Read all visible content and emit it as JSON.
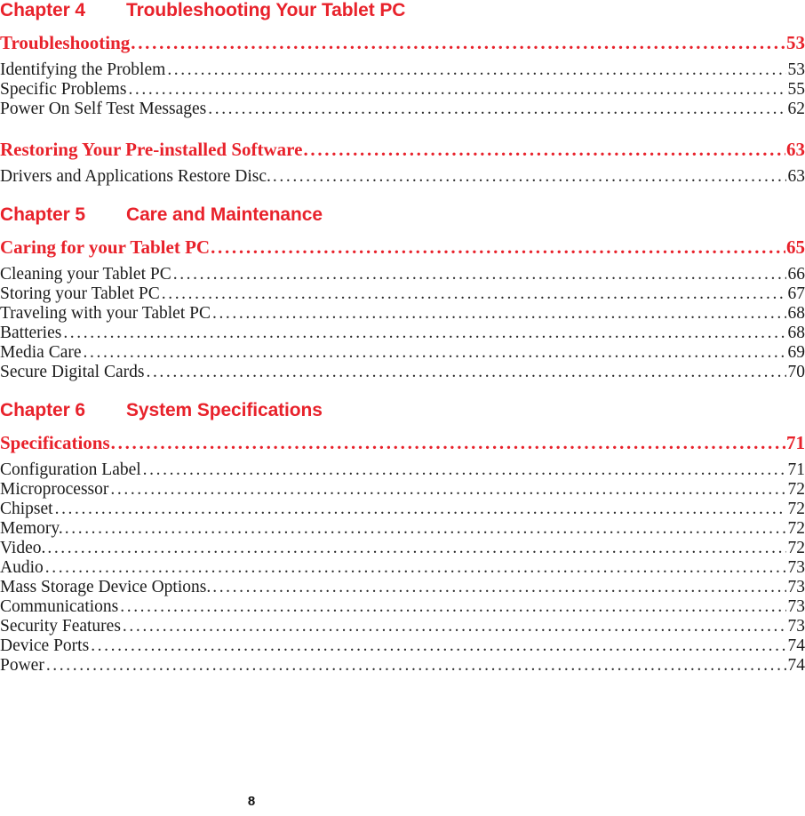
{
  "document": {
    "page_number": "8",
    "accent_color": "#E8222B",
    "body_color": "#1b1b1b",
    "leader_char": "."
  },
  "chapters": [
    {
      "label": "Chapter 4",
      "title": "Troubleshooting Your Tablet PC",
      "sections": [
        {
          "title": "Troubleshooting",
          "page": "53",
          "entries": [
            {
              "title": "Identifying the Problem",
              "page": "53"
            },
            {
              "title": "Specific Problems",
              "page": "55"
            },
            {
              "title": "Power On Self Test Messages",
              "page": "62"
            }
          ]
        },
        {
          "title": "Restoring Your Pre-installed Software",
          "page": "63",
          "entries": [
            {
              "title": "Drivers and Applications Restore Disc.",
              "page": "63"
            }
          ]
        }
      ]
    },
    {
      "label": "Chapter 5",
      "title": "Care and Maintenance",
      "sections": [
        {
          "title": "Caring for your Tablet PC",
          "page": "65",
          "entries": [
            {
              "title": "Cleaning your Tablet PC",
              "page": "66"
            },
            {
              "title": "Storing your Tablet PC",
              "page": "67"
            },
            {
              "title": "Traveling with your Tablet PC",
              "page": "68"
            },
            {
              "title": "Batteries",
              "page": "68"
            },
            {
              "title": "Media Care",
              "page": "69"
            },
            {
              "title": "Secure Digital Cards",
              "page": "70"
            }
          ]
        }
      ]
    },
    {
      "label": "Chapter 6",
      "title": "System Specifications",
      "sections": [
        {
          "title": "Specifications",
          "page": "71",
          "entries": [
            {
              "title": "Configuration Label",
              "page": "71"
            },
            {
              "title": "Microprocessor",
              "page": "72"
            },
            {
              "title": "Chipset",
              "page": "72"
            },
            {
              "title": "Memory.",
              "page": "72"
            },
            {
              "title": "Video.",
              "page": "72"
            },
            {
              "title": "Audio",
              "page": "73"
            },
            {
              "title": "Mass Storage Device Options.",
              "page": "73"
            },
            {
              "title": "Communications",
              "page": "73"
            },
            {
              "title": "Security Features",
              "page": "73"
            },
            {
              "title": "Device Ports",
              "page": "74"
            },
            {
              "title": "Power",
              "page": "74"
            }
          ]
        }
      ]
    }
  ]
}
